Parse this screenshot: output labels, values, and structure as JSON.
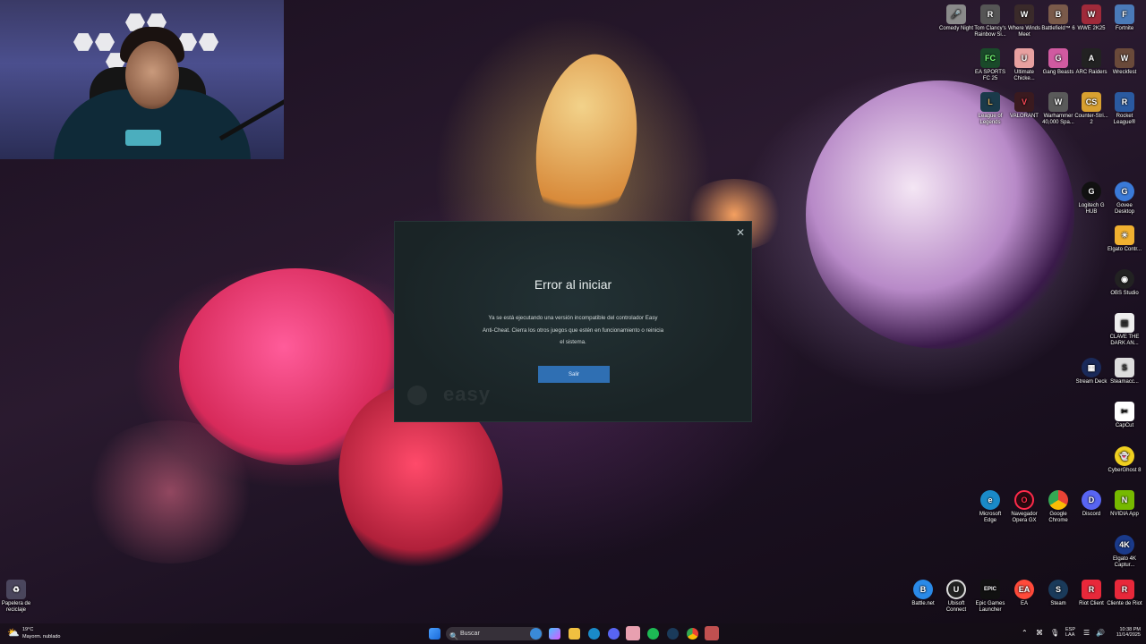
{
  "dialog": {
    "title": "Error al iniciar",
    "message_line1": "Ya se está ejecutando una versión incompatible del controlador Easy",
    "message_line2": "Anti-Cheat. Cierra los otros juegos que estén en funcionamiento o reinicia",
    "message_line3": "el sistema.",
    "button": "Salir",
    "brand": "easy"
  },
  "desktop_icons": {
    "comedy_night": "Comedy Night",
    "rainbow": "Tom Clancy's Rainbow Si...",
    "where_winds": "Where Winds Meet",
    "battlefield": "Battlefield™ 6",
    "wwe": "WWE 2K25",
    "fortnite": "Fortnite",
    "easports": "EA SPORTS FC 25",
    "ultimate_chicken": "Ultimate Chicke...",
    "gang_beasts": "Gang Beasts",
    "arc_raiders": "ARC Raiders",
    "wreckfest": "Wreckfest",
    "lol": "League of Legends",
    "valorant": "VALORANT",
    "warhammer": "Warhammer 40,000 Spa...",
    "counter_strike": "Counter-Stri... 2",
    "rocket_league": "Rocket League®",
    "logitech": "Logitech G HUB",
    "govee": "Govee Desktop",
    "elgato_control": "Elgato Contr...",
    "obs": "OBS Studio",
    "clave": "CLAVE THE DARK AN...",
    "stream_deck": "Stream Deck",
    "steamacc": "Steamacc...",
    "capcut": "CapCut",
    "cyberghost": "CyberGhost 8",
    "edge": "Microsoft Edge",
    "opera": "Navegador Opera GX",
    "chrome": "Google Chrome",
    "discord": "Discord",
    "nvidia": "NVIDIA App",
    "elgato4k": "Elgato 4K Captur...",
    "battlenet": "Battle.net",
    "ubisoft": "Ubisoft Connect",
    "epic": "Epic Games Launcher",
    "ea": "EA",
    "steam": "Steam",
    "riot": "Riot Client",
    "riot2": "Cliente de Riot",
    "recycle": "Papelera de reciclaje"
  },
  "taskbar": {
    "weather_temp": "19°C",
    "weather_desc": "Mayorm. nublado",
    "search_placeholder": "Buscar",
    "lang1": "ESP",
    "lang2": "LAA",
    "time": "10:38 PM",
    "date": "11/14/2025"
  },
  "colors": {
    "dialog_bg": "#1a2426",
    "button": "#2f6fb3"
  }
}
